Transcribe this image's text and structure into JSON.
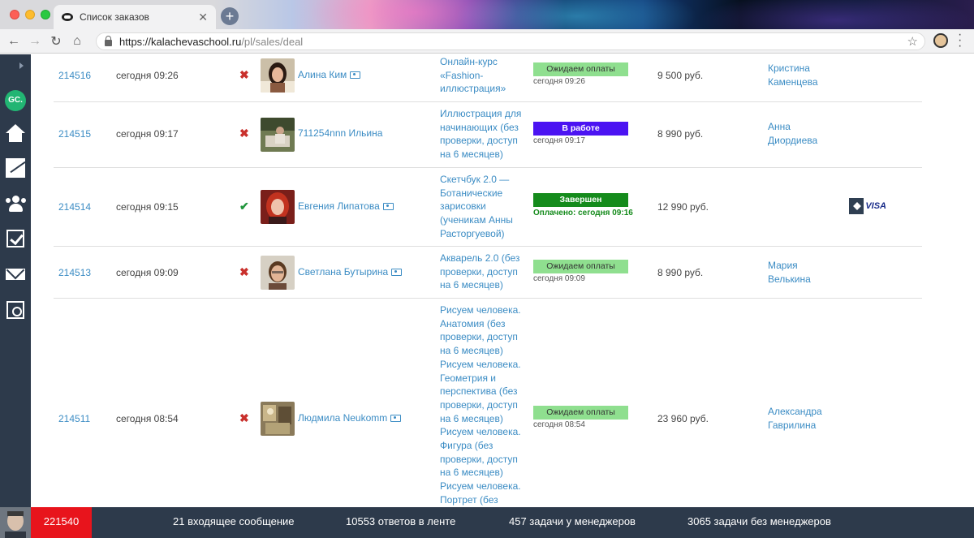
{
  "browser": {
    "tab_title": "Список заказов",
    "url_host": "https://kalachevaschool.ru",
    "url_path": "/pl/sales/deal"
  },
  "sidebar": {
    "logo_text": "GC.",
    "icons": [
      "home-icon",
      "chart-icon",
      "users-icon",
      "tasks-icon",
      "mail-icon",
      "safe-icon"
    ]
  },
  "orders": [
    {
      "id": "214516",
      "created": "сегодня 09:26",
      "paid": false,
      "customer": "Алина Ким",
      "product_lines": [
        "Онлайн-курс",
        "«Fashion-",
        "иллюстрация»"
      ],
      "status": "Ожидаем оплаты",
      "status_type": "wait",
      "status_sub": "сегодня 09:26",
      "amount": "9 500 руб.",
      "manager_lines": [
        "Кристина",
        "Каменцева"
      ]
    },
    {
      "id": "214515",
      "created": "сегодня 09:17",
      "paid": false,
      "customer": "711254nnn Ильина",
      "product_lines": [
        "Иллюстрация для",
        "начинающих (без",
        "проверки, доступ",
        "на 6 месяцев)"
      ],
      "status": "В работе",
      "status_type": "work",
      "status_sub": "сегодня 09:17",
      "amount": "8 990 руб.",
      "manager_lines": [
        "Анна",
        "Диордиева"
      ]
    },
    {
      "id": "214514",
      "created": "сегодня 09:15",
      "paid": true,
      "customer": "Евгения Липатова",
      "product_lines": [
        "Скетчбук 2.0 —",
        "Ботанические",
        "зарисовки",
        "(ученикам Анны",
        "Расторгуевой)"
      ],
      "status": "Завершен",
      "status_type": "done",
      "status_sub": "Оплачено: сегодня 09:16",
      "amount": "12 990 руб.",
      "manager_lines": [],
      "payment_label": "VISA"
    },
    {
      "id": "214513",
      "created": "сегодня 09:09",
      "paid": false,
      "customer": "Светлана Бутырина",
      "product_lines": [
        "Акварель 2.0 (без",
        "проверки, доступ",
        "на 6 месяцев)"
      ],
      "status": "Ожидаем оплаты",
      "status_type": "wait",
      "status_sub": "сегодня 09:09",
      "amount": "8 990 руб.",
      "manager_lines": [
        "Мария",
        "Велькина"
      ]
    },
    {
      "id": "214511",
      "created": "сегодня 08:54",
      "paid": false,
      "customer": "Людмила Neukomm",
      "product_lines": [
        "Рисуем человека.",
        "Анатомия (без",
        "проверки, доступ",
        "на 6 месяцев)",
        "Рисуем человека.",
        "Геометрия и",
        "перспектива (без",
        "проверки, доступ",
        "на 6 месяцев)",
        "Рисуем человека.",
        "Фигура (без",
        "проверки, доступ",
        "на 6 месяцев)",
        "Рисуем человека.",
        "Портрет (без"
      ],
      "status": "Ожидаем оплаты",
      "status_type": "wait",
      "status_sub": "сегодня 08:54",
      "amount": "23 960 руб.",
      "manager_lines": [
        "Александра",
        "Гаврилина"
      ]
    }
  ],
  "bottombar": {
    "counter": "221540",
    "incoming": "21 входящее сообщение",
    "feed": "10553 ответов в ленте",
    "with_managers": "457 задачи у менеджеров",
    "without_managers": "3065 задачи без менеджеров"
  }
}
